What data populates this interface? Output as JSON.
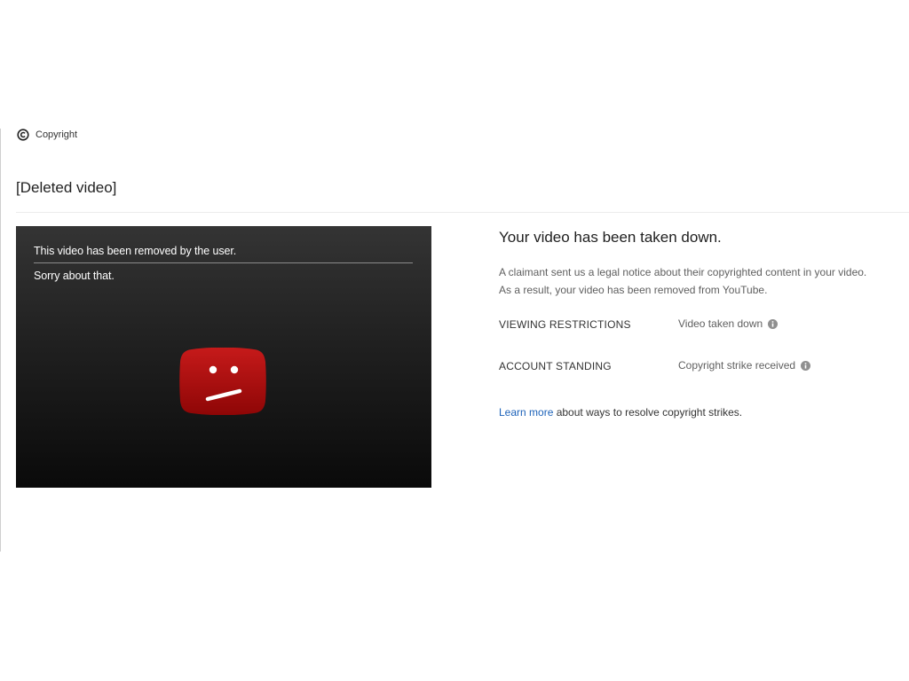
{
  "section": {
    "icon": "copyright-icon",
    "label": "Copyright"
  },
  "video": {
    "title": "[Deleted video]",
    "player": {
      "message": "This video has been removed by the user.",
      "sub_message": "Sorry about that.",
      "icon": "sad-youtube-logo-icon",
      "icon_color": "#b00b0b"
    }
  },
  "takedown": {
    "heading": "Your video has been taken down.",
    "body_line1": "A claimant sent us a legal notice about their copyrighted content in your video.",
    "body_line2": "As a result, your video has been removed from YouTube.",
    "details": [
      {
        "label": "VIEWING RESTRICTIONS",
        "value": "Video taken down",
        "icon": "info-icon"
      },
      {
        "label": "ACCOUNT STANDING",
        "value": "Copyright strike received",
        "icon": "info-icon"
      }
    ],
    "learn_more": {
      "link_text": "Learn more",
      "rest_text": " about ways to resolve copyright strikes.",
      "link_color": "#1c62b9"
    }
  }
}
